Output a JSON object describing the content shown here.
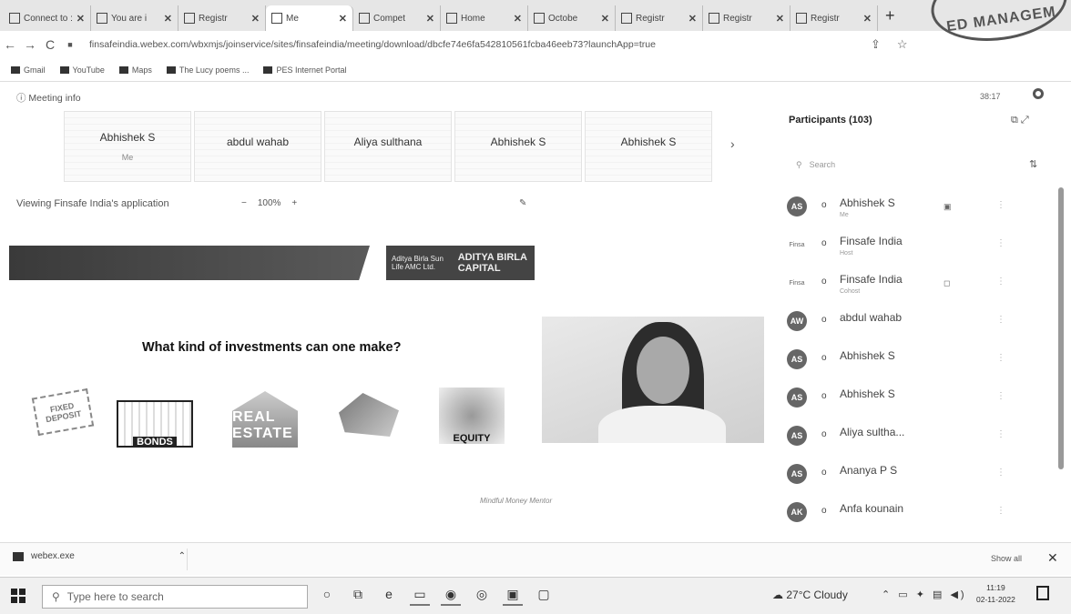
{
  "browser": {
    "tabs": [
      {
        "label": "Connect to :",
        "icon": "connect-icon"
      },
      {
        "label": "You are i",
        "icon": "page-icon"
      },
      {
        "label": "Registr",
        "icon": "gmail-icon"
      },
      {
        "label": "Me",
        "icon": "webex-icon",
        "active": true
      },
      {
        "label": "Compet",
        "icon": "site-icon"
      },
      {
        "label": "Home",
        "icon": "site-icon"
      },
      {
        "label": "Octobe",
        "icon": "site-icon"
      },
      {
        "label": "Registr",
        "icon": "page-icon"
      },
      {
        "label": "Registr",
        "icon": "page-icon"
      },
      {
        "label": "Registr",
        "icon": "page-icon"
      }
    ],
    "new_tab": "+",
    "url": "finsafeindia.webex.com/wbxmjs/joinservice/sites/finsafeindia/meeting/download/dbcfe74e6fa542810561fcba46eeb73?launchApp=true",
    "bookmarks": [
      "Gmail",
      "YouTube",
      "Maps",
      "The Lucy poems ...",
      "PES Internet Portal"
    ]
  },
  "stamp_text": "ED MANAGEM",
  "meeting": {
    "info_label": "Meeting info",
    "timer": "38:17",
    "tiles": [
      {
        "name": "Abhishek S",
        "sub": "Me"
      },
      {
        "name": "abdul wahab",
        "sub": ""
      },
      {
        "name": "Aliya sulthana",
        "sub": ""
      },
      {
        "name": "Abhishek S",
        "sub": ""
      },
      {
        "name": "Abhishek S",
        "sub": ""
      }
    ],
    "tiles_next": "›",
    "viewing_text": "Viewing Finsafe India's application",
    "zoom": {
      "minus": "−",
      "value": "100%",
      "plus": "+"
    }
  },
  "slide": {
    "logo_left": "Aditya Birla Sun Life AMC Ltd.",
    "logo_right": "ADITYA BIRLA CAPITAL",
    "title": "What kind of investments can one make?",
    "items": [
      {
        "label": "FIXED DEPOSIT"
      },
      {
        "label": "BONDS"
      },
      {
        "label": "REAL ESTATE"
      },
      {
        "label": ""
      },
      {
        "label": "EQUITY"
      }
    ],
    "signature": "Mindful Money Mentor"
  },
  "participants": {
    "title": "Participants (103)",
    "search_placeholder": "Search",
    "list": [
      {
        "initials": "AS",
        "name": "Abhishek S",
        "role": "Me",
        "mic": "o",
        "extra": "▣"
      },
      {
        "initials": "Finsa",
        "name": "Finsafe India",
        "role": "Host",
        "mic": "o",
        "extra": ""
      },
      {
        "initials": "Finsa",
        "name": "Finsafe India",
        "role": "Cohost",
        "mic": "o",
        "extra": "◻"
      },
      {
        "initials": "AW",
        "name": "abdul wahab",
        "role": "",
        "mic": "o",
        "extra": ""
      },
      {
        "initials": "AS",
        "name": "Abhishek S",
        "role": "",
        "mic": "o",
        "extra": ""
      },
      {
        "initials": "AS",
        "name": "Abhishek S",
        "role": "",
        "mic": "o",
        "extra": ""
      },
      {
        "initials": "AS",
        "name": "Aliya sultha...",
        "role": "",
        "mic": "o",
        "extra": ""
      },
      {
        "initials": "AS",
        "name": "Ananya P S",
        "role": "",
        "mic": "o",
        "extra": ""
      },
      {
        "initials": "AK",
        "name": "Anfa kounain",
        "role": "",
        "mic": "o",
        "extra": ""
      }
    ]
  },
  "downloads": {
    "file": "webex.exe",
    "show_all": "Show all"
  },
  "taskbar": {
    "search_placeholder": "Type here to search",
    "weather": "27°C  Cloudy",
    "time": "11:19",
    "date": "02-11-2022"
  }
}
